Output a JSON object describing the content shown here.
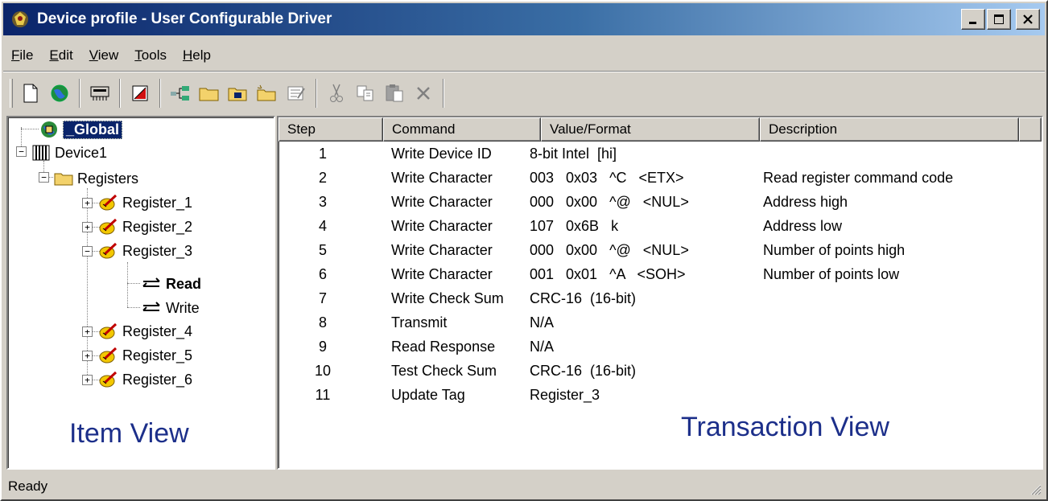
{
  "window": {
    "title": "Device profile - User Configurable Driver"
  },
  "menu": [
    {
      "pre": "",
      "u": "F",
      "post": "ile"
    },
    {
      "pre": "",
      "u": "E",
      "post": "dit"
    },
    {
      "pre": "",
      "u": "V",
      "post": "iew"
    },
    {
      "pre": "",
      "u": "T",
      "post": "ools"
    },
    {
      "pre": "",
      "u": "H",
      "post": "elp"
    }
  ],
  "toolbar": {
    "icons": [
      "new-file-icon",
      "globe-icon",
      "device-icon",
      "register-icon",
      "hierarchy-icon",
      "folder-icon",
      "folder-open-icon",
      "folder-new-icon",
      "properties-icon",
      "cut-icon",
      "copy-icon",
      "paste-icon",
      "delete-icon"
    ]
  },
  "tree": {
    "global": "_Global",
    "device": "Device1",
    "registers_folder": "Registers",
    "reg1": "Register_1",
    "reg2": "Register_2",
    "reg3": "Register_3",
    "read": "Read",
    "write": "Write",
    "reg4": "Register_4",
    "reg5": "Register_5",
    "reg6": "Register_6"
  },
  "labels": {
    "item_view": "Item View",
    "transaction_view": "Transaction View"
  },
  "list": {
    "headers": {
      "step": "Step",
      "command": "Command",
      "value": "Value/Format",
      "description": "Description"
    },
    "rows": [
      {
        "step": "1",
        "command": "Write Device ID",
        "value": "8-bit Intel  [hi]",
        "description": ""
      },
      {
        "step": "2",
        "command": "Write Character",
        "value": "003   0x03   ^C   <ETX>",
        "description": "Read register command code"
      },
      {
        "step": "3",
        "command": "Write Character",
        "value": "000   0x00   ^@   <NUL>",
        "description": "Address high"
      },
      {
        "step": "4",
        "command": "Write Character",
        "value": "107   0x6B   k",
        "description": "Address low"
      },
      {
        "step": "5",
        "command": "Write Character",
        "value": "000   0x00   ^@   <NUL>",
        "description": "Number of points high"
      },
      {
        "step": "6",
        "command": "Write Character",
        "value": "001   0x01   ^A   <SOH>",
        "description": "Number of points low"
      },
      {
        "step": "7",
        "command": "Write Check Sum",
        "value": "CRC-16  (16-bit)",
        "description": ""
      },
      {
        "step": "8",
        "command": "Transmit",
        "value": "N/A",
        "description": ""
      },
      {
        "step": "9",
        "command": "Read Response",
        "value": "N/A",
        "description": ""
      },
      {
        "step": "10",
        "command": "Test Check Sum",
        "value": "CRC-16  (16-bit)",
        "description": ""
      },
      {
        "step": "11",
        "command": "Update Tag",
        "value": "Register_3",
        "description": ""
      }
    ]
  },
  "status": {
    "text": "Ready"
  }
}
